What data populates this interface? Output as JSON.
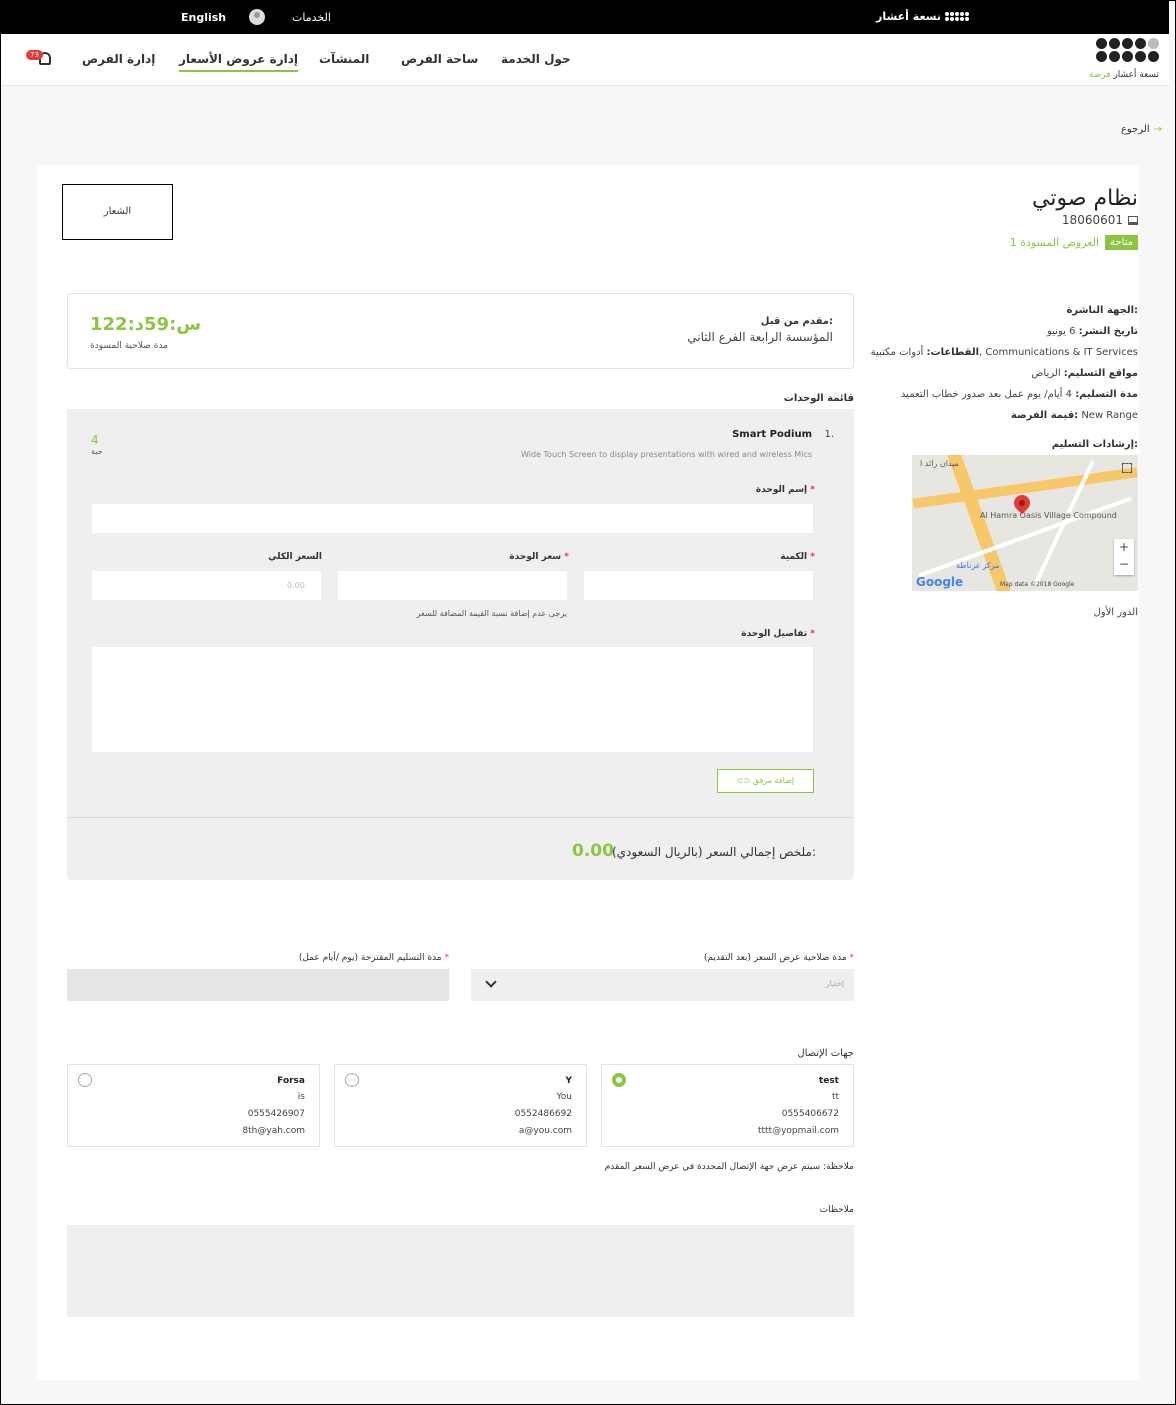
{
  "topbar": {
    "brand": "نسعة أعشار",
    "language": "English",
    "services": "الخدمات"
  },
  "logo": {
    "text": "تسعة أعشار",
    "accent": "فرصة"
  },
  "nav": {
    "about": "حول الخدمة",
    "opportunities": "ساحة الفرص",
    "facilities": "المنشآت",
    "quotes": "إدارة عروض الأسعار",
    "manage": "إدارة الفرص",
    "notifications": "73"
  },
  "back": "الرجوع",
  "logo_placeholder": "الشعار",
  "opportunity": {
    "title": "نظام صوتي",
    "ref": "18060601",
    "status": "متاحة",
    "drafts": "1 العروض المسودة"
  },
  "info": {
    "issuer_label": "الجهة الناشرة:",
    "issuer": "",
    "date_label": "تاريخ النشر:",
    "date": "6 يونيو",
    "sectors_label": "القطاعات:",
    "sectors": "أدوات مكتبية, Communications & IT Services",
    "locations_label": "مواقع التسليم:",
    "locations": "الرياض",
    "duration_label": "مدة التسليم:",
    "duration": "4 أيام/ يوم عمل بعد صدور خطاب التعميد",
    "value_label": "قيمة الفرصة:",
    "value": "New Range",
    "directions_label": "إرشادات التسليم:",
    "floor": "الدور الأول"
  },
  "map": {
    "place": "Al Hamra Oasis Village Compound",
    "poi1": "مركز غرناطة",
    "poi2": "ميدان رائد ا",
    "attribution": "Map data ©2018 Google",
    "google": "Google"
  },
  "offer": {
    "by_label": "مقدم من قبل:",
    "by": "المؤسسة الرابعة الفرع الثاني",
    "timer": "1س:59د:22",
    "timer_label": "مدة صلاحية المسودة"
  },
  "units": {
    "title": "قائمة الوحدات",
    "items": [
      {
        "num": "1.",
        "name": "Smart Podium",
        "desc": "Wide Touch Screen to display presentations with wired and wireless Mics",
        "qty": "4",
        "qty_label": "حبة"
      }
    ],
    "name_label": "إسم الوحدة",
    "qty_label": "الكمية",
    "price_label": "سعر الوحدة",
    "total_label": "السعر الكلي",
    "total_value": "0.00",
    "vat_hint": "يرجى عدم إضافة نسبة القيمة المضافة للسعر",
    "details_label": "تفاصيل الوحدة",
    "attach": "إضافة مرفق",
    "summary_label": "ملخص إجمالي السعر (بالريال السعودي):",
    "summary_value": "0.00"
  },
  "validity": {
    "label": "مدة صلاحية عرض السعر (بعد التقديم)",
    "placeholder": "إختيار"
  },
  "delivery": {
    "label": "مدة التسليم المقترحة (يوم /أيام عمل)"
  },
  "contacts": {
    "title": "جهات الإتصال",
    "items": [
      {
        "name": "test",
        "line1": "tt",
        "phone": "0555406672",
        "email": "tttt@yopmail.com",
        "selected": true
      },
      {
        "name": "Y",
        "line1": "You",
        "phone": "0552486692",
        "email": "a@you.com",
        "selected": false
      },
      {
        "name": "Forsa",
        "line1": "is",
        "phone": "0555426907",
        "email": "8th@yah.com",
        "selected": false
      }
    ],
    "note": "ملاحظة: سيتم عرض جهة الإتصال المحددة في عرض السعر المقدم"
  },
  "notes": {
    "label": "ملاحظات"
  },
  "colors": {
    "accent": "#8cc63f",
    "required": "#e53935"
  }
}
